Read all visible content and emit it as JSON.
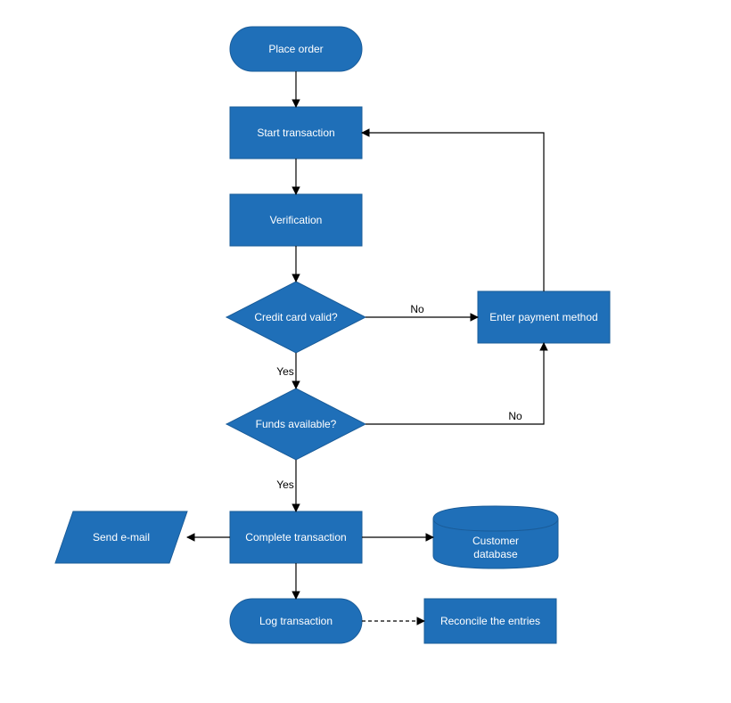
{
  "colors": {
    "fill": "#1f6fb8",
    "stroke": "#1a5c99",
    "edge": "#000000"
  },
  "nodes": {
    "place_order": "Place order",
    "start_txn": "Start transaction",
    "verify": "Verification",
    "cc_valid": "Credit card valid?",
    "funds": "Funds available?",
    "enter_pm": "Enter payment method",
    "complete": "Complete transaction",
    "send_mail": "Send e-mail",
    "cust_db_l1": "Customer",
    "cust_db_l2": "database",
    "log_txn": "Log transaction",
    "reconcile": "Reconcile the entries"
  },
  "labels": {
    "yes": "Yes",
    "no": "No"
  }
}
